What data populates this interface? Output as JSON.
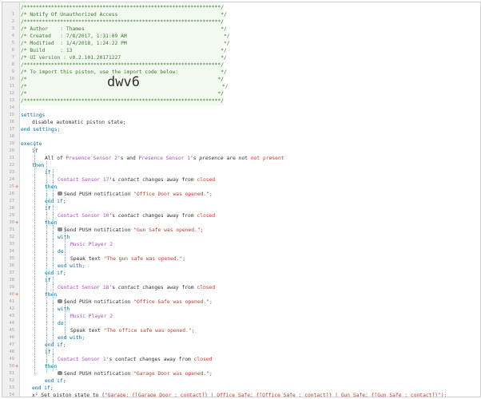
{
  "lines": [
    {
      "n": "1"
    },
    {
      "n": "2"
    },
    {
      "n": "3"
    },
    {
      "n": "4"
    },
    {
      "n": "5"
    },
    {
      "n": "6"
    },
    {
      "n": "7"
    },
    {
      "n": "8"
    },
    {
      "n": "9"
    },
    {
      "n": "10"
    },
    {
      "n": "11"
    },
    {
      "n": "12"
    },
    {
      "n": "13"
    },
    {
      "n": "14"
    },
    {
      "n": "15"
    },
    {
      "n": "16"
    },
    {
      "n": "17"
    },
    {
      "n": "18"
    },
    {
      "n": "19"
    },
    {
      "n": "20"
    },
    {
      "n": "21"
    },
    {
      "n": "22"
    },
    {
      "n": "23"
    },
    {
      "n": "24"
    },
    {
      "n": "25"
    },
    {
      "n": "26"
    },
    {
      "n": "27"
    },
    {
      "n": "28"
    },
    {
      "n": "29"
    },
    {
      "n": "30"
    },
    {
      "n": "31"
    },
    {
      "n": "32"
    },
    {
      "n": "33"
    },
    {
      "n": "34"
    },
    {
      "n": "35"
    },
    {
      "n": "36"
    },
    {
      "n": "37"
    },
    {
      "n": "38"
    },
    {
      "n": "39"
    },
    {
      "n": "40"
    },
    {
      "n": "41"
    },
    {
      "n": "42"
    },
    {
      "n": "43"
    },
    {
      "n": "44"
    },
    {
      "n": "45"
    },
    {
      "n": "46"
    },
    {
      "n": "47"
    },
    {
      "n": "48"
    },
    {
      "n": "49"
    },
    {
      "n": "50"
    },
    {
      "n": "51"
    },
    {
      "n": "52"
    },
    {
      "n": "53"
    },
    {
      "n": "54"
    },
    {
      "n": "55"
    }
  ],
  "markers": [
    "+",
    "+",
    "+",
    "+"
  ],
  "header": {
    "border": "/*****************************************************************/",
    "title": "/* Notify Of Unauthorized Access                                  */",
    "author": "/* Author    : Thames                                             */",
    "created": "/* Created   : 7/8/2017, 1:31:09 AM                                */",
    "modified": "/* Modified  : 1/4/2018, 1:24:22 PM                                */",
    "build": "/* Build     : 13                                                 */",
    "ui": "/* UI version : v0.2.101.20171227                                 */",
    "import_hint": "/* To import this piston, use the import code below:              */",
    "blank": "/*                                                               */",
    "code_open": "/*",
    "code_close": "*/",
    "import_code": "dwv6"
  },
  "kw": {
    "settings": "settings",
    "end_settings": "end settings;",
    "execute": "execute",
    "end_execute": "end execute;",
    "if": "if",
    "then": "then",
    "end_if": "end if;",
    "with": "with",
    "do": "do",
    "end_with": "end with;"
  },
  "text": {
    "disable": "disable automatic piston state;",
    "all_of": "All of ",
    "and": "'s and ",
    "s": "'s ",
    "presence": "presence",
    "are_not": " are not ",
    "not_present": "not present",
    "contact": "contact",
    "changes": " changes away from ",
    "closed": "closed",
    "send_push": "Send PUSH notification ",
    "speak": "Speak text ",
    "set_state_pre": "Set piston state to ",
    "x2": "x²"
  },
  "devices": {
    "presence2": "Presence Sensor 2",
    "presence1": "Presence Sensor 1",
    "contact17": "Contact Sensor 17",
    "contact10": "Contact Sensor 10",
    "contact18": "Contact Sensor 18",
    "contact1": "Contact Sensor 1",
    "music": "Music Player 2"
  },
  "strings": {
    "office_door": "\"Office Door was opened.\";",
    "gun_safe": "\"Gun Safe was opened.\";",
    "gun_speak": "\"The gun safe was opened.\";",
    "office_safe": "\"Office Safe was opened.\";",
    "office_speak": "\"The office safe was opened.\";",
    "garage_door": "\"Garage Door was opened.\";",
    "state": "\"Garage: {[Garage Door : contact]} | Office Safe: {[Office Safe : contact]} | Gun Safe: {[Gun Safe : contact]}\"",
    "state_end": ");"
  }
}
